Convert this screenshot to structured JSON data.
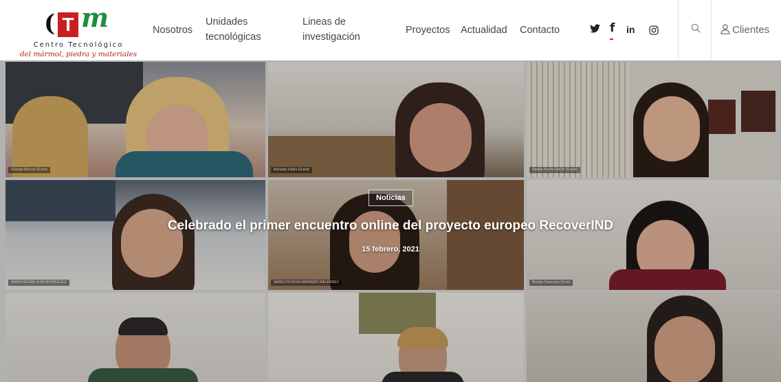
{
  "logo": {
    "name": "Centro Tecnológico",
    "subtitle": "del mármol, piedra y materiales"
  },
  "nav": {
    "nosotros": "Nosotros",
    "unidades_line1": "Unidades",
    "unidades_line2": "tecnológicas",
    "lineas_line1": "Lineas de",
    "lineas_line2": "investigación",
    "proyectos": "Proyectos",
    "actualidad": "Actualidad",
    "contacto": "Contacto"
  },
  "social": {
    "facebook": "f",
    "linkedin": "in"
  },
  "account": {
    "clientes": "Clientes"
  },
  "hero": {
    "category": "Noticias",
    "title": "Celebrado el primer encuentro online del proyecto europeo RecoverIND",
    "date": "15 febrero, 2021"
  },
  "participants": [
    "Georgia Baroud (Guest)",
    "Manuela Fabila (Guest)",
    "Natalia Puerta RAISE (Guest)",
    "MARIA DESIRE ALBA RODRIGUEZ",
    "MADELYN ROSA MARRERO MELENDEZ",
    "Monika Sewczyka (Gost)",
    "",
    "",
    ""
  ],
  "colors": {
    "brand_red": "#c8201f",
    "brand_green": "#1f8f3a",
    "nav_text": "#444444"
  }
}
